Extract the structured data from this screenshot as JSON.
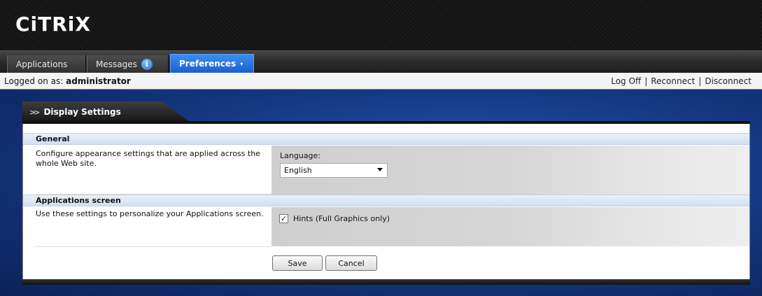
{
  "brand": {
    "logo_text": "CiTRiX"
  },
  "nav": {
    "tabs": [
      {
        "label": "Applications"
      },
      {
        "label": "Messages",
        "icon": "info-icon"
      },
      {
        "label": "Preferences",
        "icon": "chevron-down-icon",
        "active": true
      }
    ],
    "info_glyph": "i",
    "chevron_glyph": "▾"
  },
  "status": {
    "logged_prefix": "Logged on as: ",
    "user": "administrator",
    "links": [
      "Log Off",
      "Reconnect",
      "Disconnect"
    ],
    "separator": "|"
  },
  "panel": {
    "tab_title": "Display Settings",
    "sections": [
      {
        "title": "General",
        "description": "Configure appearance settings that are applied across the whole Web site.",
        "field_label": "Language:",
        "select_value": "English"
      },
      {
        "title": "Applications screen",
        "description": "Use these settings to personalize your Applications screen.",
        "checkbox_label": "Hints (Full Graphics only)",
        "checkbox_checked": true,
        "check_glyph": "✓"
      }
    ],
    "buttons": {
      "save": "Save",
      "cancel": "Cancel"
    }
  },
  "colors": {
    "active_tab": "#2b74e0",
    "header_bg": "#161616",
    "backdrop": "#1a4496"
  }
}
